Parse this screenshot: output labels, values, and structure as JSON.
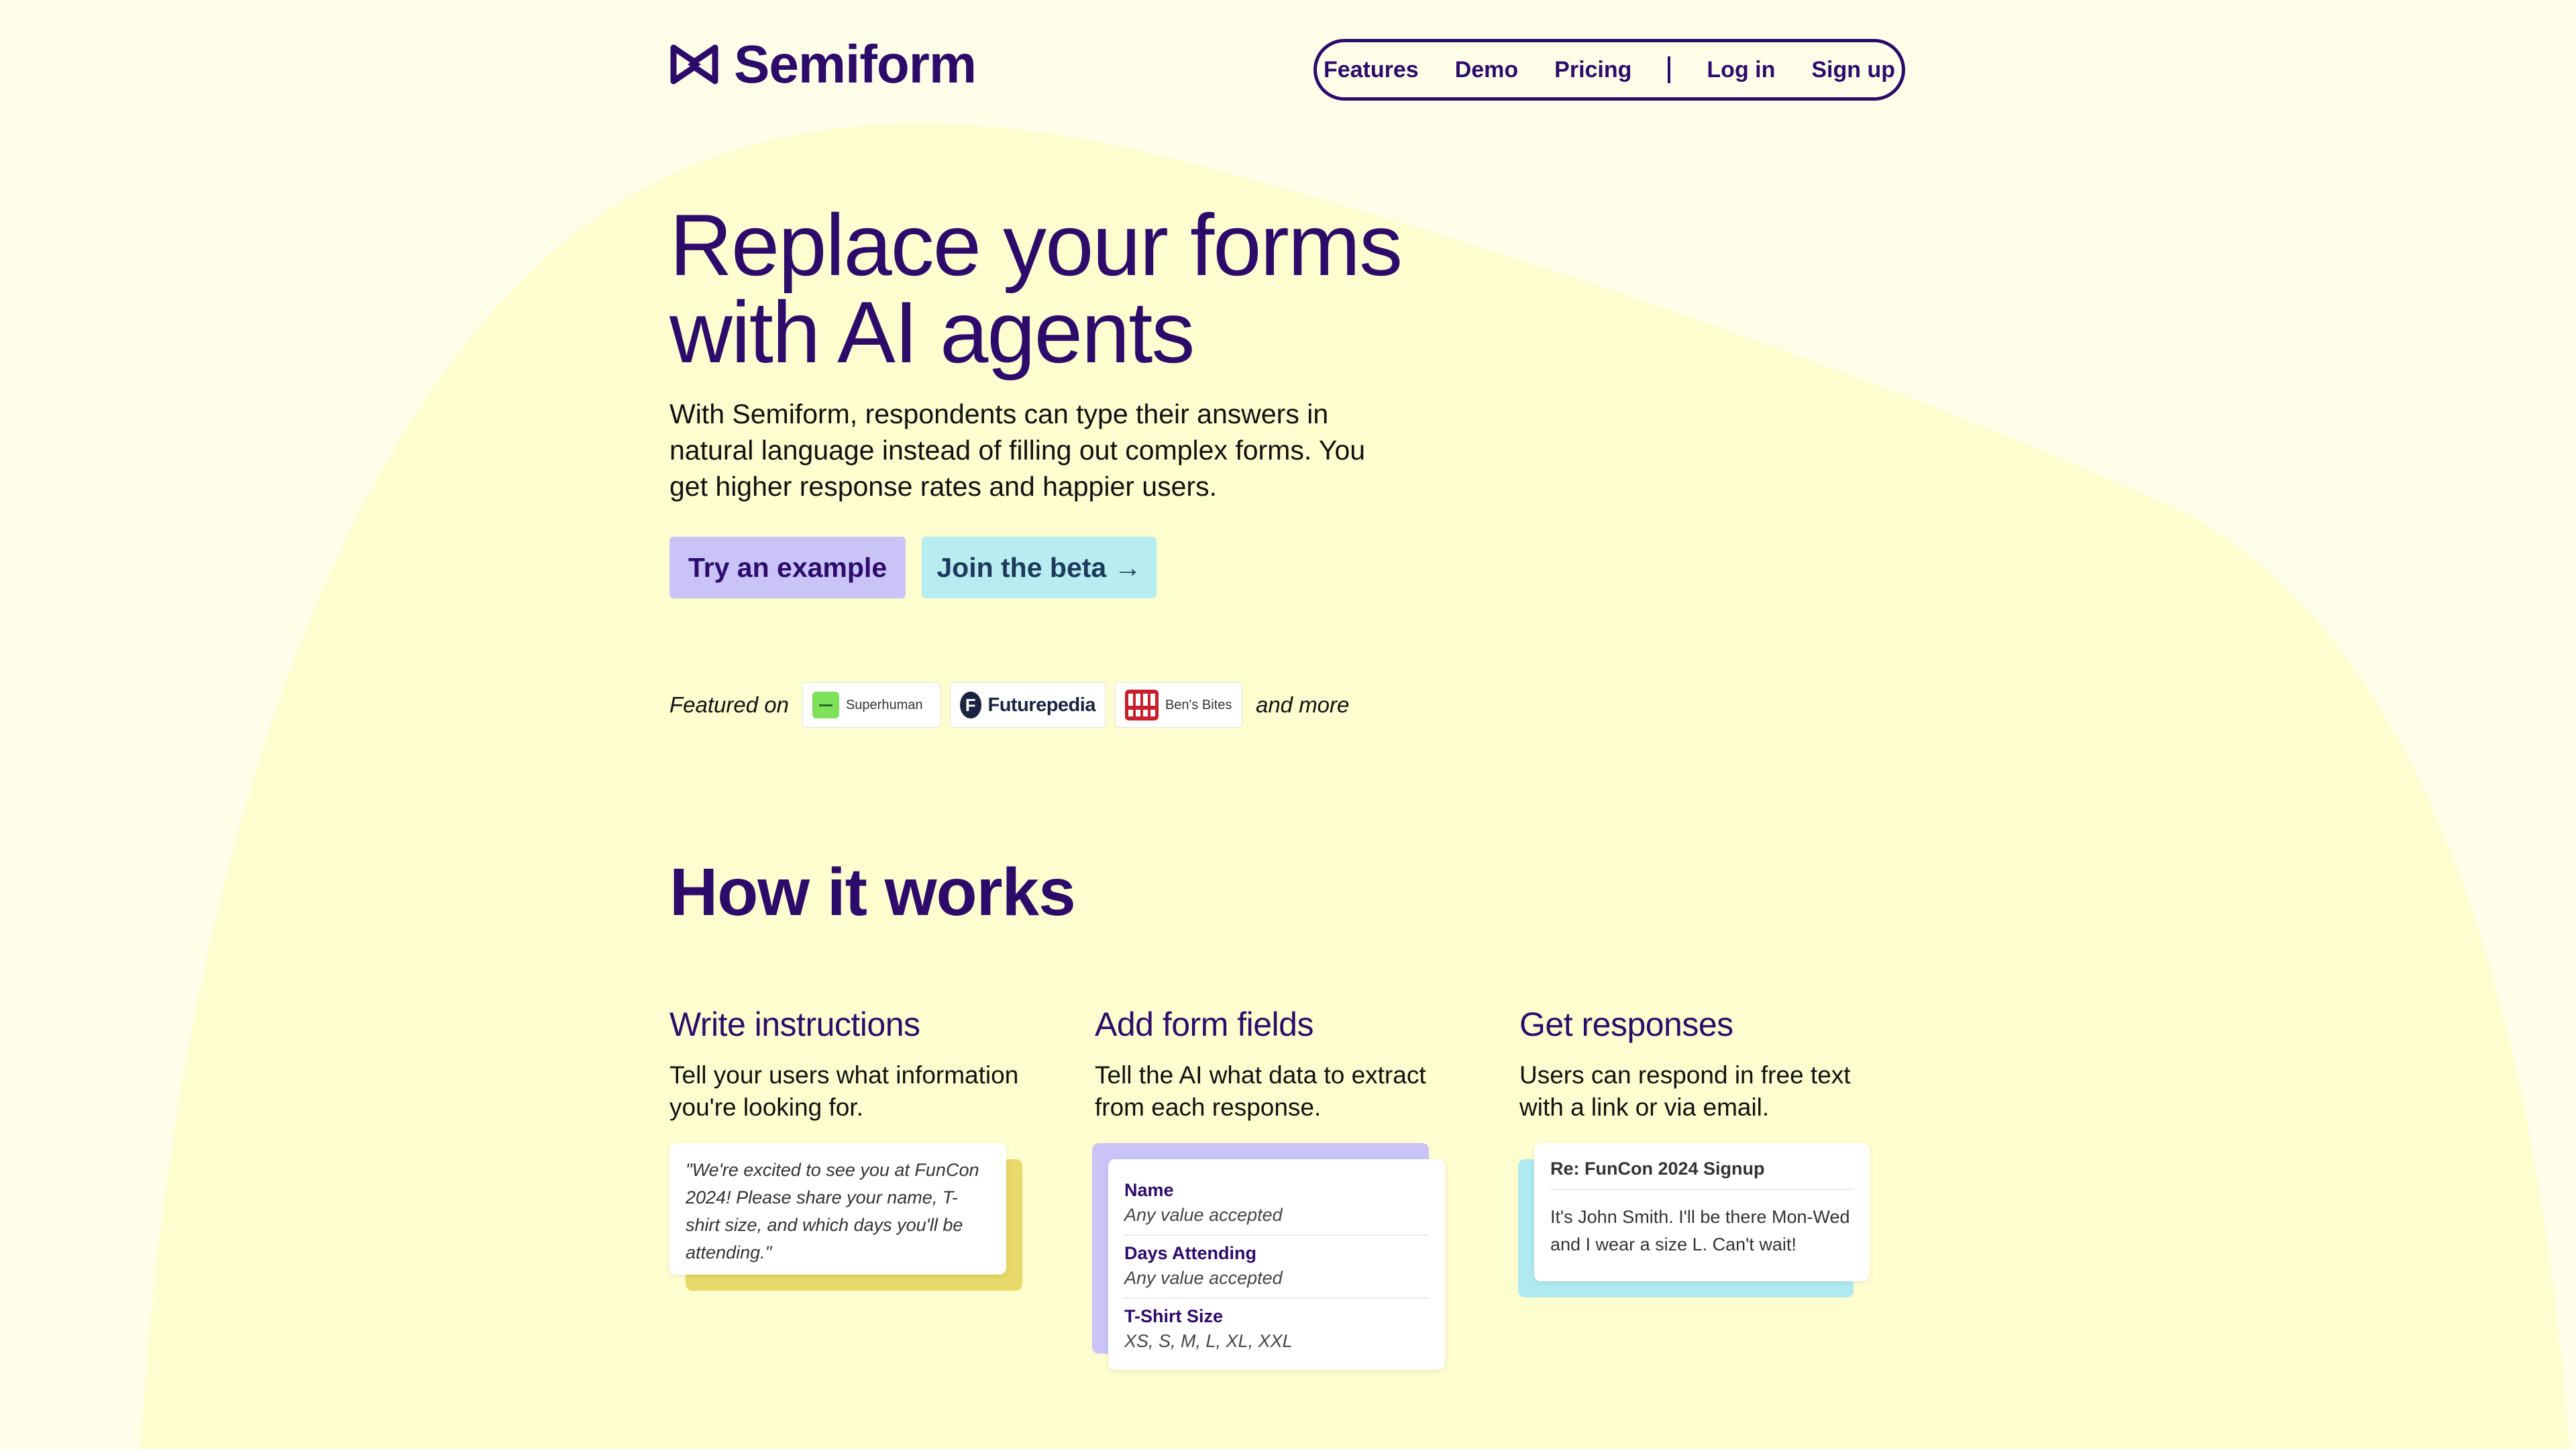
{
  "brand": {
    "name": "Semiform"
  },
  "nav": {
    "features": "Features",
    "demo": "Demo",
    "pricing": "Pricing",
    "login": "Log in",
    "signup": "Sign up"
  },
  "hero": {
    "title_line1": "Replace your forms",
    "title_line2": "with AI agents",
    "subtitle": "With Semiform, respondents can type their answers in natural language instead of filling out complex forms. You get higher response rates and happier users.",
    "try_button": "Try an example",
    "beta_button": "Join the beta →"
  },
  "featured": {
    "label": "Featured on",
    "badges": [
      "Superhuman",
      "Futurepedia",
      "Ben's Bites"
    ],
    "more": "and more"
  },
  "how": {
    "title": "How it works",
    "steps": [
      {
        "title": "Write instructions",
        "text": "Tell your users what information you're looking for.",
        "card_text": "\"We're excited to see you at FunCon 2024! Please share your name, T-shirt size, and which days you'll be attending.\""
      },
      {
        "title": "Add form fields",
        "text": "Tell the AI what data to extract from each response.",
        "fields": [
          {
            "name": "Name",
            "value": "Any value accepted"
          },
          {
            "name": "Days Attending",
            "value": "Any value accepted"
          },
          {
            "name": "T-Shirt Size",
            "value": "XS, S, M, L, XL, XXL"
          }
        ]
      },
      {
        "title": "Get responses",
        "text": "Users can respond in free text with a link or via email.",
        "mail_subject": "Re: FunCon 2024 Signup",
        "mail_body": "It's John Smith. I'll be there Mon-Wed and I wear a size L. Can't wait!"
      }
    ]
  },
  "colors": {
    "background": "#fefee8",
    "blob": "#fdfdcf",
    "brand": "#2d0b6b",
    "try_button": "#c9c3f7",
    "beta_button": "#b7ecf0",
    "yellow_accent": "#e8d96a",
    "cyan_accent": "#aeeaf0"
  }
}
